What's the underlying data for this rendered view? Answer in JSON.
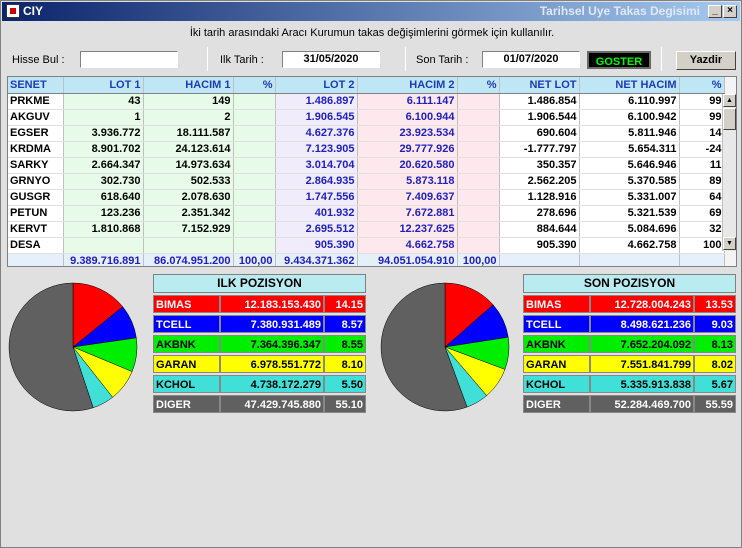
{
  "window": {
    "title": "CIY",
    "caption": "Tarihsel Uye Takas Degisimi"
  },
  "subtitle": "İki tarih arasındaki  Aracı Kurumun takas değişimlerini görmek için kullanılır.",
  "controls": {
    "hisse_label": "Hisse Bul :",
    "hisse_value": "",
    "ilk_label": "Ilk Tarih :",
    "ilk_value": "31/05/2020",
    "son_label": "Son Tarih :",
    "son_value": "01/07/2020",
    "goster_label": "GOSTER",
    "yazdir_label": "Yazdir"
  },
  "table": {
    "headers": [
      "SENET",
      "LOT 1",
      "HACIM 1",
      "%",
      "LOT 2",
      "HACIM 2",
      "%",
      "NET LOT",
      "NET HACIM",
      "%"
    ],
    "rows": [
      [
        "PRKME",
        "43",
        "149",
        "",
        "1.486.897",
        "6.111.147",
        "",
        "1.486.854",
        "6.110.997",
        "99"
      ],
      [
        "AKGUV",
        "1",
        "2",
        "",
        "1.906.545",
        "6.100.944",
        "",
        "1.906.544",
        "6.100.942",
        "99"
      ],
      [
        "EGSER",
        "3.936.772",
        "18.111.587",
        "",
        "4.627.376",
        "23.923.534",
        "",
        "690.604",
        "5.811.946",
        "14"
      ],
      [
        "KRDMA",
        "8.901.702",
        "24.123.614",
        "",
        "7.123.905",
        "29.777.926",
        "",
        "-1.777.797",
        "5.654.311",
        "-24"
      ],
      [
        "SARKY",
        "2.664.347",
        "14.973.634",
        "",
        "3.014.704",
        "20.620.580",
        "",
        "350.357",
        "5.646.946",
        "11"
      ],
      [
        "GRNYO",
        "302.730",
        "502.533",
        "",
        "2.864.935",
        "5.873.118",
        "",
        "2.562.205",
        "5.370.585",
        "89"
      ],
      [
        "GUSGR",
        "618.640",
        "2.078.630",
        "",
        "1.747.556",
        "7.409.637",
        "",
        "1.128.916",
        "5.331.007",
        "64"
      ],
      [
        "PETUN",
        "123.236",
        "2.351.342",
        "",
        "401.932",
        "7.672.881",
        "",
        "278.696",
        "5.321.539",
        "69"
      ],
      [
        "KERVT",
        "1.810.868",
        "7.152.929",
        "",
        "2.695.512",
        "12.237.625",
        "",
        "884.644",
        "5.084.696",
        "32"
      ],
      [
        "DESA",
        "",
        "",
        "",
        "905.390",
        "4.662.758",
        "",
        "905.390",
        "4.662.758",
        "100"
      ]
    ],
    "totals": [
      "",
      "9.389.716.891",
      "86.074.951.200",
      "100,00",
      "9.434.371.362",
      "94.051.054.910",
      "100,00",
      "",
      "",
      ""
    ]
  },
  "ilk": {
    "title": "ILK POZISYON",
    "rows": [
      {
        "name": "BIMAS",
        "value": "12.183.153.430",
        "pct": "14.15",
        "share": 14.15,
        "bg": "#ff0000",
        "fg": "#ffffff"
      },
      {
        "name": "TCELL",
        "value": "7.380.931.489",
        "pct": "8.57",
        "share": 8.57,
        "bg": "#0000ff",
        "fg": "#ffffff"
      },
      {
        "name": "AKBNK",
        "value": "7.364.396.347",
        "pct": "8.55",
        "share": 8.55,
        "bg": "#00ee00",
        "fg": "#000000"
      },
      {
        "name": "GARAN",
        "value": "6.978.551.772",
        "pct": "8.10",
        "share": 8.1,
        "bg": "#ffff00",
        "fg": "#000000"
      },
      {
        "name": "KCHOL",
        "value": "4.738.172.279",
        "pct": "5.50",
        "share": 5.5,
        "bg": "#40e0d8",
        "fg": "#000000"
      },
      {
        "name": "DIGER",
        "value": "47.429.745.880",
        "pct": "55.10",
        "share": 55.1,
        "bg": "#606060",
        "fg": "#ffffff"
      }
    ]
  },
  "son": {
    "title": "SON POZISYON",
    "rows": [
      {
        "name": "BIMAS",
        "value": "12.728.004.243",
        "pct": "13.53",
        "share": 13.53,
        "bg": "#ff0000",
        "fg": "#ffffff"
      },
      {
        "name": "TCELL",
        "value": "8.498.621.236",
        "pct": "9.03",
        "share": 9.03,
        "bg": "#0000ff",
        "fg": "#ffffff"
      },
      {
        "name": "AKBNK",
        "value": "7.652.204.092",
        "pct": "8.13",
        "share": 8.13,
        "bg": "#00ee00",
        "fg": "#000000"
      },
      {
        "name": "GARAN",
        "value": "7.551.841.799",
        "pct": "8.02",
        "share": 8.02,
        "bg": "#ffff00",
        "fg": "#000000"
      },
      {
        "name": "KCHOL",
        "value": "5.335.913.838",
        "pct": "5.67",
        "share": 5.67,
        "bg": "#40e0d8",
        "fg": "#000000"
      },
      {
        "name": "DIGER",
        "value": "52.284.469.700",
        "pct": "55.59",
        "share": 55.59,
        "bg": "#606060",
        "fg": "#ffffff"
      }
    ]
  },
  "icons": {
    "app": "app-icon",
    "minimize": "minimize-icon",
    "close": "close-icon",
    "scroll_up": "scroll-up-icon",
    "scroll_down": "scroll-down-icon"
  }
}
